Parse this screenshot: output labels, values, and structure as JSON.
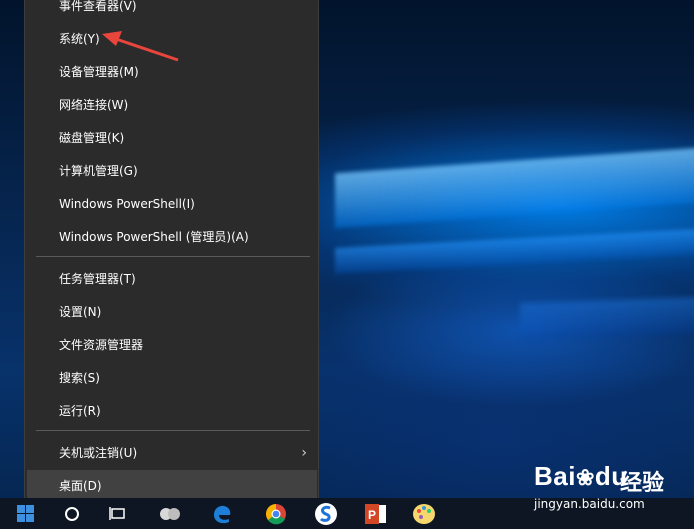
{
  "menu": {
    "items": [
      {
        "label": "事件查看器(V)"
      },
      {
        "label": "系统(Y)"
      },
      {
        "label": "设备管理器(M)"
      },
      {
        "label": "网络连接(W)"
      },
      {
        "label": "磁盘管理(K)"
      },
      {
        "label": "计算机管理(G)"
      },
      {
        "label": "Windows PowerShell(I)"
      },
      {
        "label": "Windows PowerShell (管理员)(A)"
      },
      {
        "label": "任务管理器(T)"
      },
      {
        "label": "设置(N)"
      },
      {
        "label": "文件资源管理器"
      },
      {
        "label": "搜索(S)"
      },
      {
        "label": "运行(R)"
      },
      {
        "label": "关机或注销(U)",
        "submenu": true
      },
      {
        "label": "桌面(D)"
      }
    ]
  },
  "watermark": {
    "brand": "Bai",
    "brand_suffix": "du",
    "cn": "经验",
    "url": "jingyan.baidu.com"
  },
  "colors": {
    "menu_bg": "#2b2b2b",
    "menu_hover": "#414141",
    "arrow": "#e8453c",
    "taskbar": "#0e1624"
  },
  "taskbar_icons": [
    "windows-start-icon",
    "cortana-search-icon",
    "task-view-icon",
    "people-icon",
    "edge-browser-icon",
    "chrome-browser-icon",
    "sogou-icon",
    "powerpoint-icon",
    "paint-icon"
  ]
}
